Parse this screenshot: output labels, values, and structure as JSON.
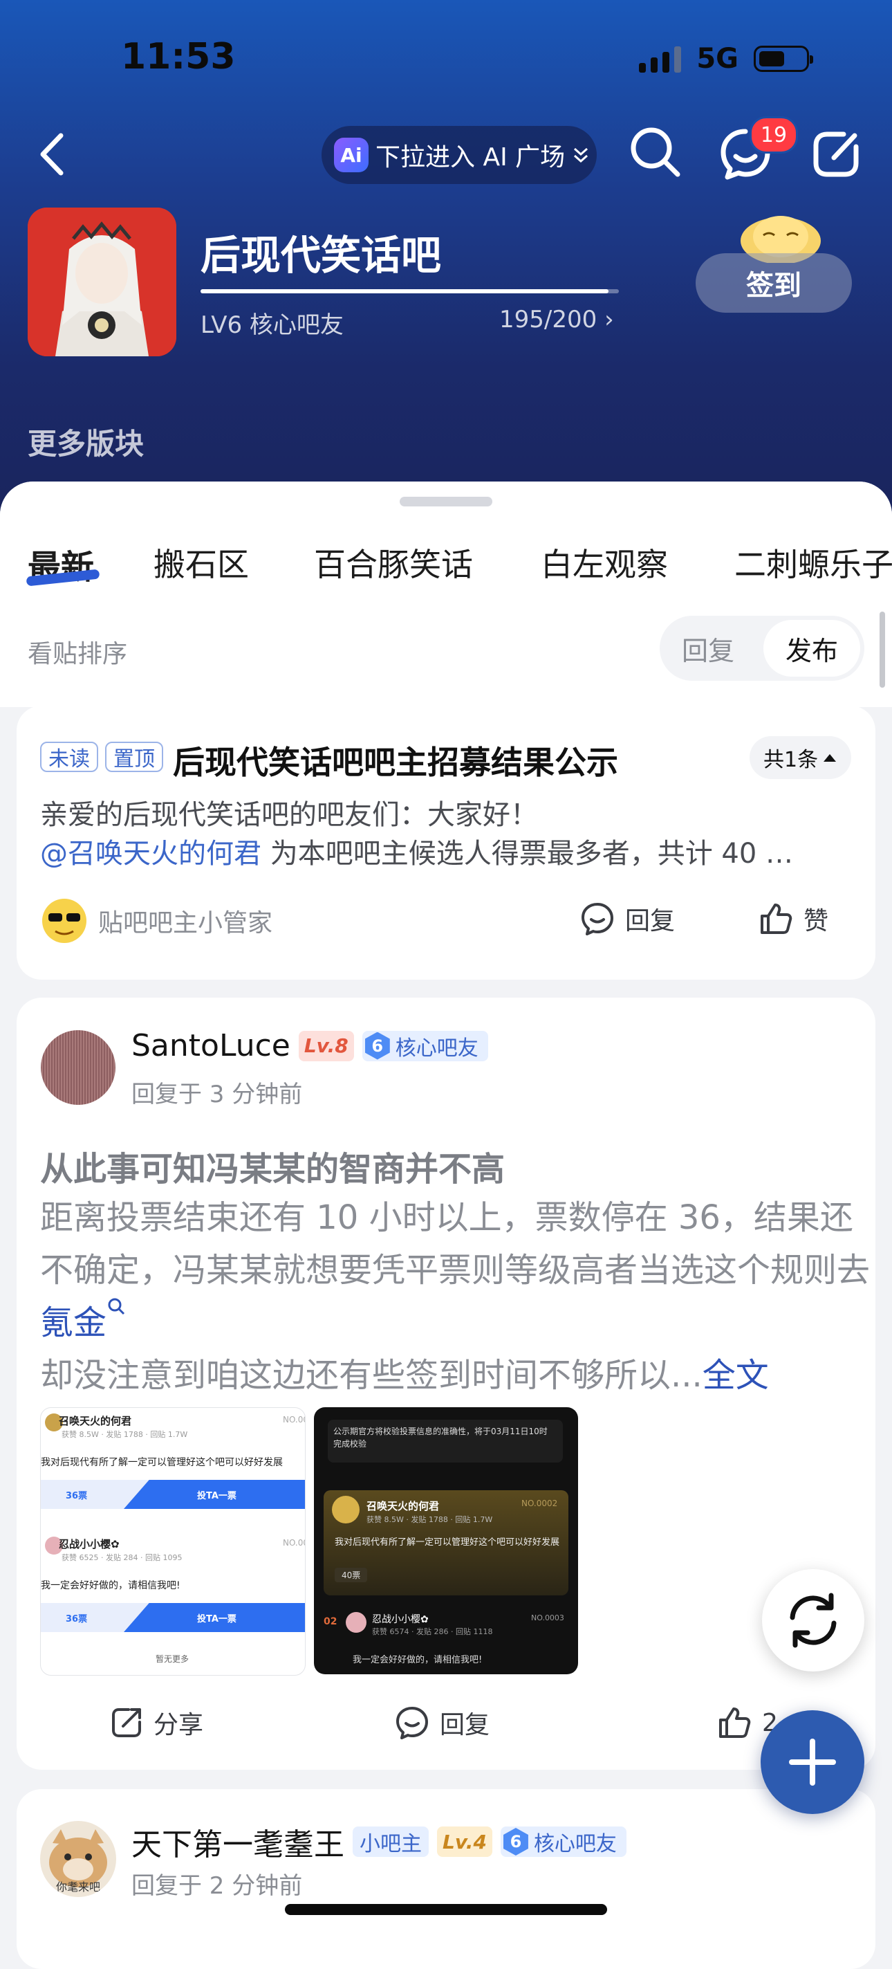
{
  "status_bar": {
    "time": "11:53",
    "network": "5G"
  },
  "nav": {
    "ai_pill_badge": "Ai",
    "ai_pill_text": "下拉进入 AI 广场",
    "message_badge": "19"
  },
  "forum": {
    "title": "后现代笑话吧",
    "level_text": "LV6 核心吧友",
    "level_count": "195/200",
    "level_progress": 0.975,
    "signin_label": "签到",
    "more_blocks": "更多版块"
  },
  "tabs": [
    "最新",
    "搬石区",
    "百合豚笑话",
    "白左观察",
    "二刺螈乐子"
  ],
  "sort": {
    "label": "看贴排序",
    "option_reply": "回复",
    "option_publish": "发布"
  },
  "pinned": {
    "tag_unread": "未读",
    "tag_top": "置顶",
    "title": "后现代笑话吧吧主招募结果公示",
    "count": "共1条",
    "line1": "亲爱的后现代笑话吧的吧友们：大家好！",
    "mention": "@召唤天火的何君",
    "line2_rest": " 为本吧吧主候选人得票最多者，共计 40 …",
    "author": "贴吧吧主小管家",
    "reply_label": "回复",
    "like_label": "赞"
  },
  "post1": {
    "username": "SantoLuce",
    "level": "Lv.8",
    "core_num": "6",
    "core_label": "核心吧友",
    "time": "回复于 3 分钟前",
    "title": "从此事可知冯某某的智商并不高",
    "body_a": "距离投票结束还有 10 小时以上，票数停在 36，结果还不确定，冯某某就想要凭平票则等级高者当选这个规则去",
    "body_link": "氪金",
    "body_b": "却没注意到咱这边还有些签到时间不够所以...",
    "full_text": "全文",
    "share_label": "分享",
    "reply_label": "回复",
    "like_count": "2",
    "thumb1": {
      "name1": "召唤天火的何君",
      "stats1": "获赞 8.5W · 发贴 1788 · 回贴 1.7W",
      "quote1": "我对后现代有所了解一定可以管理好这个吧可以好好发展",
      "votes1": "36票",
      "vote_btn": "投TA一票",
      "no1": "NO.00",
      "name2": "忍战小小樱✿",
      "stats2": "获赞 6525 · 发贴 284 · 回贴 1095",
      "quote2": "我一定会好好做的，请相信我吧!",
      "votes2": "36票",
      "no2": "NO.00",
      "more": "暂无更多"
    },
    "thumb2": {
      "notice": "公示期官方将校验投票信息的准确性，将于03月11日10时完成校验",
      "name1": "召唤天火的何君",
      "no1": "NO.0002",
      "stats1": "获赞 8.5W · 发贴 1788 · 回贴 1.7W",
      "quote1": "我对后现代有所了解一定可以管理好这个吧可以好好发展",
      "votes1": "40票",
      "rank2": "02",
      "name2": "忍战小小樱✿",
      "no2": "NO.0003",
      "stats2": "获赞 6574 · 发贴 286 · 回贴 1118",
      "quote2": "我一定会好好做的，请相信我吧!"
    }
  },
  "post2": {
    "username": "天下第一耄耋王",
    "tag_small_owner": "小吧主",
    "level": "Lv.4",
    "core_num": "6",
    "core_label": "核心吧友",
    "time": "回复于 2 分钟前",
    "avatar_caption": "你耄来吧"
  },
  "colors": {
    "accent": "#2d5bd6",
    "badge_red": "#ff3b42",
    "link": "#2d52b8"
  }
}
